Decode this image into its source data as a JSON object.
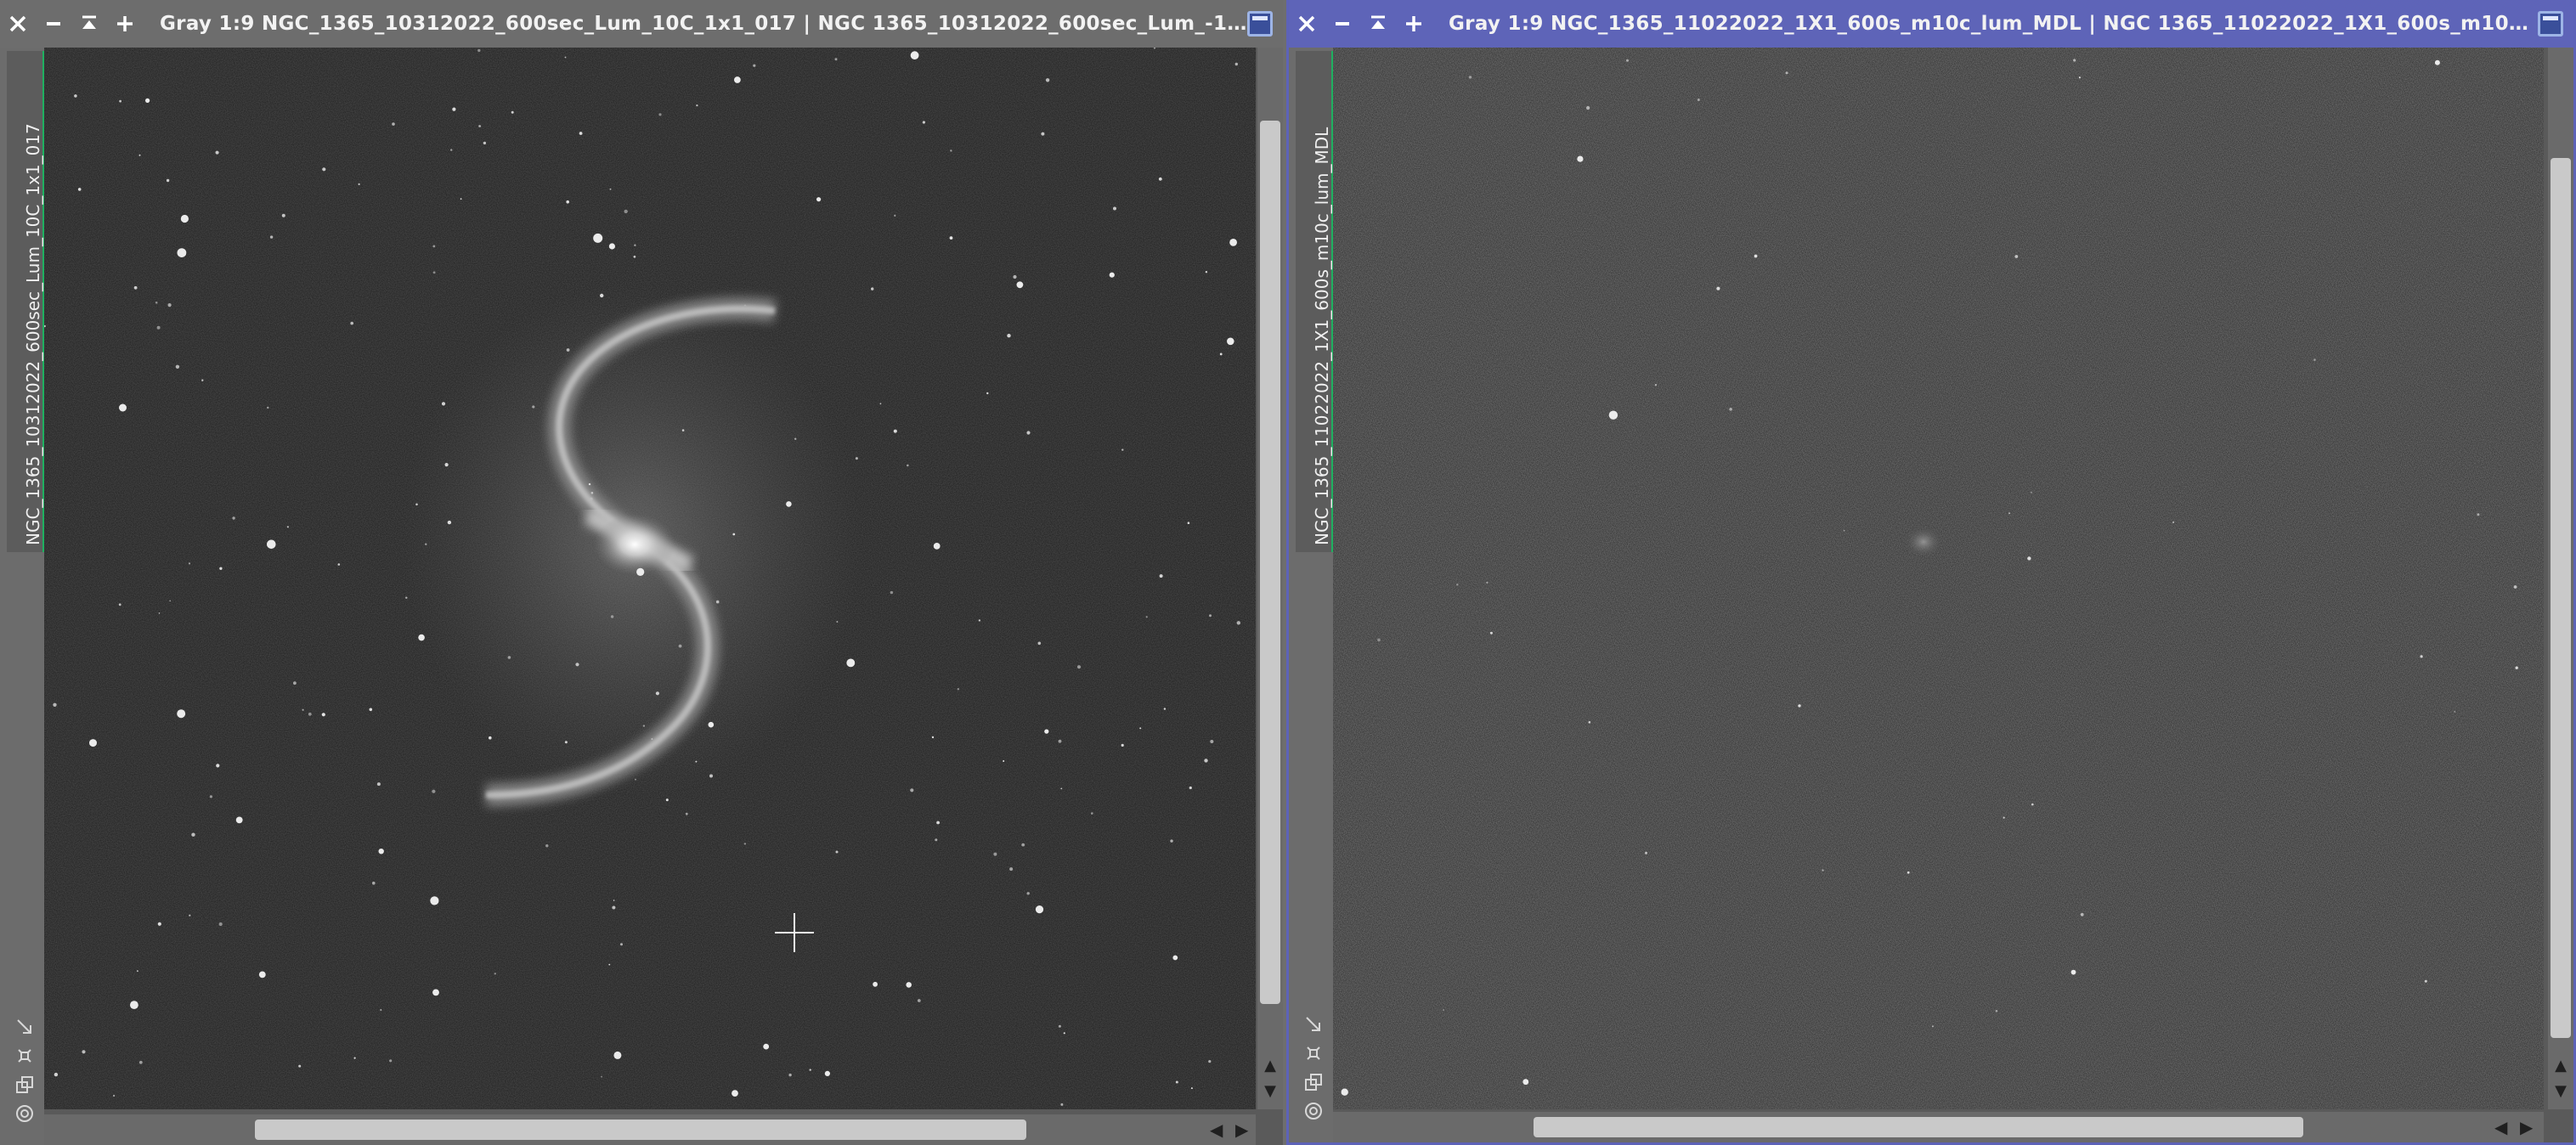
{
  "windows": [
    {
      "title": "Gray 1:9 NGC_1365_10312022_600sec_Lum_10C_1x1_017 | NGC 1365_10312022_600sec_Lum_-10C_1...",
      "side_tab": "NGC_1365_10312022_600sec_Lum_10C_1x1_017",
      "active": false
    },
    {
      "title": "Gray 1:9 NGC_1365_11022022_1X1_600s_m10c_lum_MDL | NGC 1365_11022022_1X1_600s_m10c_lum...",
      "side_tab": "NGC_1365_11022022_1X1_600s_m10c_lum_MDL",
      "active": true
    }
  ],
  "titlebar_buttons": [
    "close-icon",
    "minimize-icon",
    "shade-up-icon",
    "add-icon"
  ],
  "side_icons": [
    "fit-arrow-icon",
    "zoom-fit-icon",
    "clone-icon",
    "target-icon"
  ],
  "colors": {
    "active_titlebar": "#5e64b8",
    "inactive_titlebar": "#6d6d6d",
    "tab_accent": "#1fb060"
  }
}
